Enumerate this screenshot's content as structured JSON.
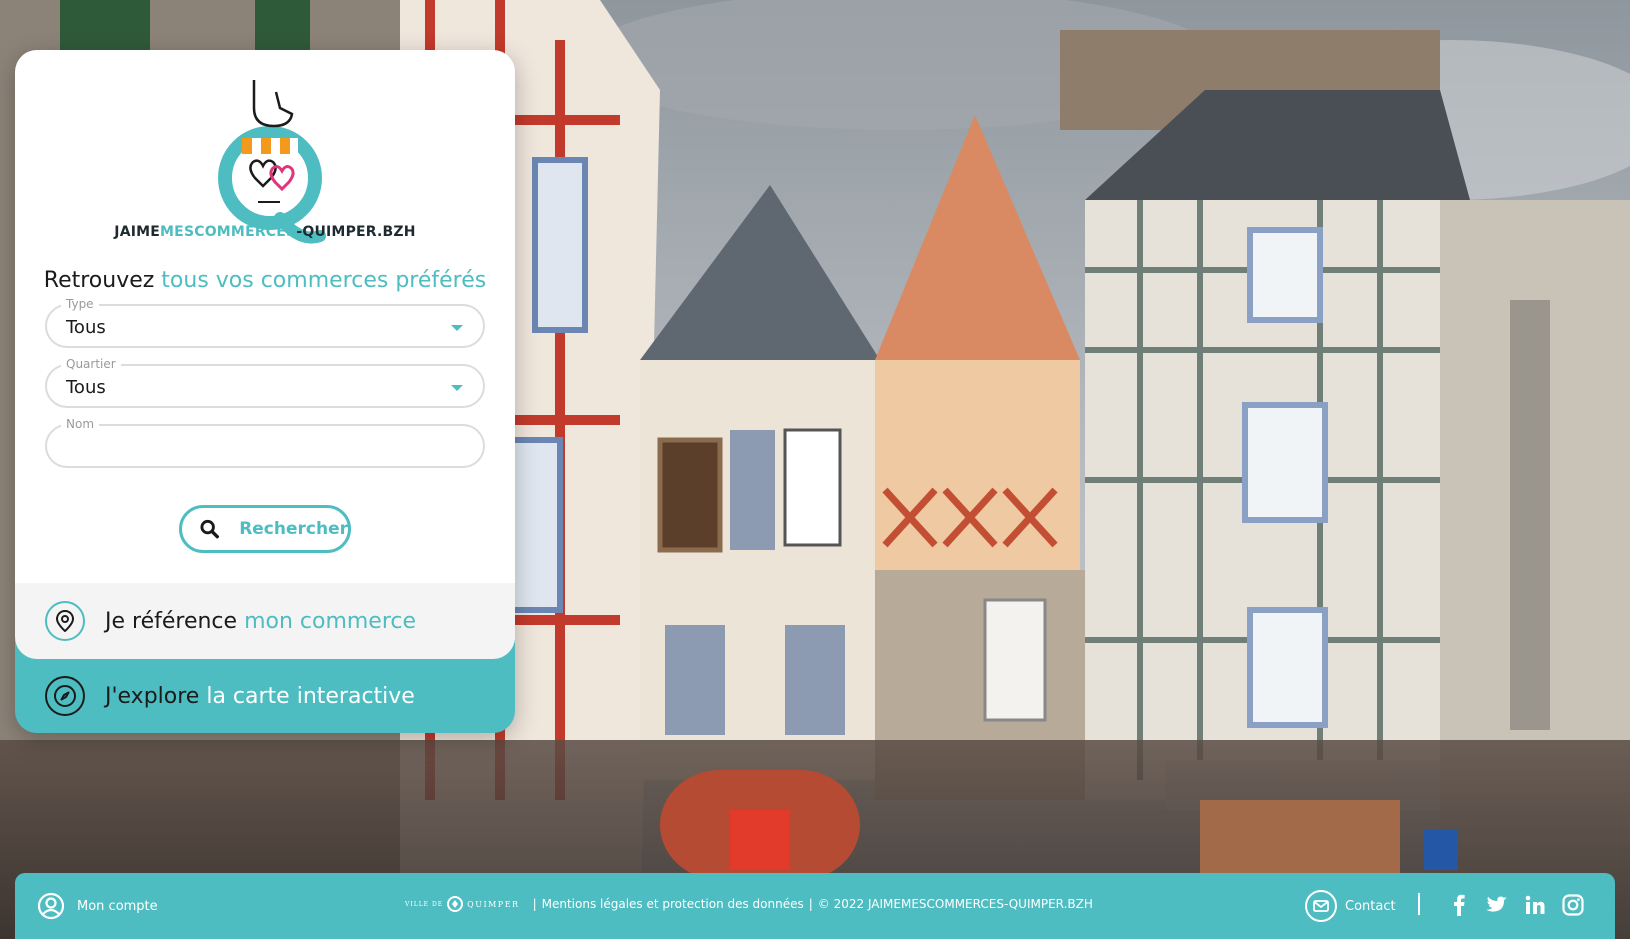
{
  "site": {
    "logo_text_part1": "JAIME",
    "logo_text_part2": "MESCOMMERCES",
    "logo_text_part3": "-QUIMPER.BZH"
  },
  "search": {
    "headline_part1": "Retrouvez ",
    "headline_part2": "tous vos commerces préférés",
    "type_label": "Type",
    "type_value": "Tous",
    "quartier_label": "Quartier",
    "quartier_value": "Tous",
    "nom_label": "Nom",
    "nom_value": "",
    "search_button": "Rechercher"
  },
  "cta": {
    "reference_part1": "Je référence ",
    "reference_part2": "mon commerce",
    "explore_part1": "J'explore ",
    "explore_part2": "la carte interactive"
  },
  "footer": {
    "account_label": "Mon compte",
    "ville_small": "VILLE DE",
    "ville_big": "QUIMPER",
    "separator": "|",
    "legal_link": "Mentions légales et protection des données",
    "copyright": "© 2022 JAIMEMESCOMMERCES-QUIMPER.BZH",
    "contact_label": "Contact",
    "social_icons": [
      "facebook-icon",
      "twitter-icon",
      "linkedin-icon",
      "instagram-icon"
    ]
  },
  "colors": {
    "accent": "#4dbdc1",
    "text": "#1b1b1b",
    "logo_pink": "#e0357d",
    "logo_orange": "#f39a1d"
  }
}
